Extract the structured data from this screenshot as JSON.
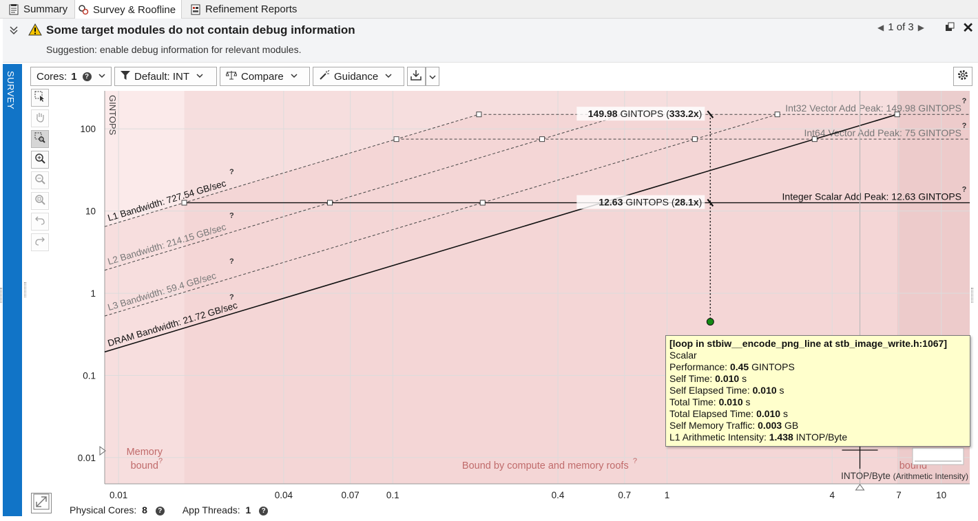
{
  "tabs": [
    {
      "label": "Summary",
      "icon": "report-icon",
      "active": false
    },
    {
      "label": "Survey & Roofline",
      "icon": "roofline-icon",
      "active": true
    },
    {
      "label": "Refinement Reports",
      "icon": "refinement-icon",
      "active": false
    }
  ],
  "banner": {
    "title": "Some target modules do not contain debug information",
    "suggestion": "Suggestion: enable debug information for relevant modules.",
    "pager": "1 of 3",
    "warning_color": "#f5c400"
  },
  "side_panel_label": "SURVEY",
  "toolbar": {
    "cores_label": "Cores:",
    "cores_value": "1",
    "filter_label": "Default: INT",
    "compare_label": "Compare",
    "guidance_label": "Guidance"
  },
  "chart_data": {
    "type": "scatter",
    "title": "",
    "ylabel": "GINTOPS",
    "xlabel": "INTOP/Byte",
    "xlabel_suffix": "(Arithmetic Intensity)",
    "scale": "log-log",
    "xlim": [
      0.0089,
      12.7
    ],
    "ylim": [
      0.0048,
      290
    ],
    "x_ticks": [
      {
        "v": 0.01,
        "l": "0.01"
      },
      {
        "v": 0.04,
        "l": "0.04"
      },
      {
        "v": 0.07,
        "l": "0.07"
      },
      {
        "v": 0.1,
        "l": "0.1"
      },
      {
        "v": 0.4,
        "l": "0.4"
      },
      {
        "v": 0.7,
        "l": "0.7"
      },
      {
        "v": 1,
        "l": "1"
      },
      {
        "v": 4,
        "l": "4"
      },
      {
        "v": 7,
        "l": "7"
      },
      {
        "v": 10,
        "l": "10"
      }
    ],
    "y_ticks": [
      {
        "v": 0.01,
        "l": "0.01"
      },
      {
        "v": 0.1,
        "l": "0.1"
      },
      {
        "v": 1,
        "l": "1"
      },
      {
        "v": 10,
        "l": "10"
      },
      {
        "v": 100,
        "l": "100"
      }
    ],
    "bandwidth_roofs": [
      {
        "name": "L1 Bandwidth",
        "value_label": "727.54 GB/sec",
        "gb_per_sec": 727.54,
        "style": "dashed",
        "label": "L1 Bandwidth: 727.54 GB/sec"
      },
      {
        "name": "L2 Bandwidth",
        "value_label": "214.15 GB/sec",
        "gb_per_sec": 214.15,
        "style": "dashed",
        "label": "L2 Bandwidth: 214.15 GB/sec"
      },
      {
        "name": "L3 Bandwidth",
        "value_label": "59.4 GB/sec",
        "gb_per_sec": 59.4,
        "style": "dashed",
        "label": "L3 Bandwidth: 59.4 GB/sec"
      },
      {
        "name": "DRAM Bandwidth",
        "value_label": "21.72 GB/sec",
        "gb_per_sec": 21.72,
        "style": "solid",
        "label": "DRAM Bandwidth: 21.72 GB/sec"
      }
    ],
    "compute_roofs": [
      {
        "name": "Int32 Vector Add Peak",
        "gintops": 149.98,
        "style": "dashed",
        "label": "Int32 Vector Add Peak: 149.98 GINTOPS"
      },
      {
        "name": "Int64 Vector Add Peak",
        "gintops": 75,
        "style": "dashed",
        "label": "Int64 Vector Add Peak: 75 GINTOPS"
      },
      {
        "name": "Integer Scalar Add Peak",
        "gintops": 12.63,
        "style": "solid",
        "label": "Integer Scalar Add Peak: 12.63 GINTOPS"
      }
    ],
    "roof_markers": [
      {
        "value": "149.98",
        "unit": "GINTOPS",
        "ratio": "(333.2x)"
      },
      {
        "value": "12.63",
        "unit": "GINTOPS",
        "ratio": "(28.1x)"
      }
    ],
    "points": [
      {
        "x": 1.438,
        "y": 0.45,
        "color": "#138a13",
        "name": "loop in stbiw__encode_png_line at stb_image_write.h:1067"
      }
    ],
    "regions": {
      "memory_bound": "Memory bound",
      "compute_and_memory": "Bound by compute and memory roofs",
      "compute_bound": "bound"
    }
  },
  "tooltip": {
    "title": "[loop in stbiw__encode_png_line at stb_image_write.h:1067]",
    "type": "Scalar",
    "rows": [
      {
        "label": "Performance: ",
        "value": "0.45",
        "unit": " GINTOPS"
      },
      {
        "label": "Self Time: ",
        "value": "0.010",
        "unit": " s"
      },
      {
        "label": "Self Elapsed Time: ",
        "value": "0.010",
        "unit": " s"
      },
      {
        "label": "Total Time: ",
        "value": "0.010",
        "unit": " s"
      },
      {
        "label": "Total Elapsed Time: ",
        "value": "0.010",
        "unit": " s"
      },
      {
        "label": "Self Memory Traffic: ",
        "value": "0.003",
        "unit": " GB"
      },
      {
        "label": "L1 Arithmetic Intensity: ",
        "value": "1.438",
        "unit": " INTOP/Byte"
      }
    ]
  },
  "status": {
    "physical_cores_label": "Physical Cores:",
    "physical_cores": "8",
    "app_threads_label": "App Threads:",
    "app_threads": "1"
  }
}
